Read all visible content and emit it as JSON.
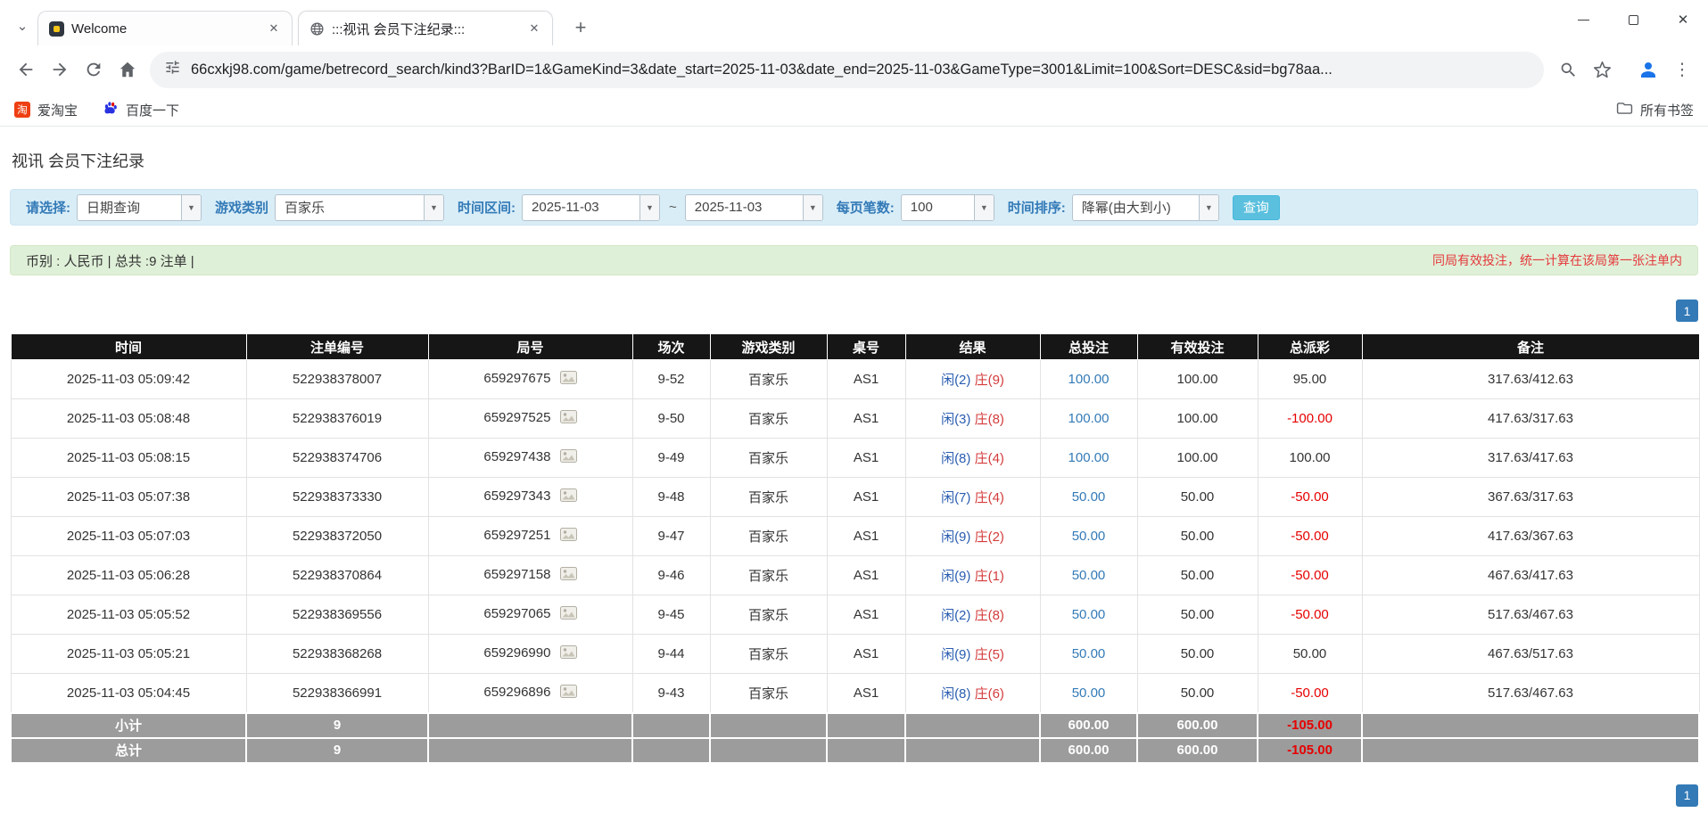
{
  "icons": {
    "chevron_down": "⌄",
    "combo_caret": "▼",
    "close": "✕",
    "plus": "+",
    "menu_dots": "⋮"
  },
  "browser": {
    "tabs": [
      {
        "title": "Welcome"
      },
      {
        "title": ":::视讯 会员下注纪录:::"
      }
    ],
    "url": "66cxkj98.com/game/betrecord_search/kind3?BarID=1&GameKind=3&date_start=2025-11-03&date_end=2025-11-03&GameType=3001&Limit=100&Sort=DESC&sid=bg78aa...",
    "bookmarks": {
      "taobao_label": "爱淘宝",
      "taobao_icon_text": "淘",
      "baidu_label": "百度一下",
      "all_bookmarks_label": "所有书签"
    }
  },
  "page": {
    "title": "视讯 会员下注纪录",
    "filters": {
      "select_label": "请选择:",
      "select_value": "日期查询",
      "game_type_label": "游戏类别",
      "game_type_value": "百家乐",
      "date_range_label": "时间区间:",
      "date_start": "2025-11-03",
      "date_separator": "~",
      "date_end": "2025-11-03",
      "page_size_label": "每页笔数:",
      "page_size_value": "100",
      "sort_label": "时间排序:",
      "sort_value": "降幂(由大到小)",
      "search_button": "查询"
    },
    "summary": {
      "left": "币别 : 人民币 | 总共 :9 注单 |",
      "right": "同局有效投注，统一计算在该局第一张注单内"
    },
    "pagination": "1",
    "table": {
      "headers": [
        "时间",
        "注单编号",
        "局号",
        "场次",
        "游戏类别",
        "桌号",
        "结果",
        "总投注",
        "有效投注",
        "总派彩",
        "备注"
      ],
      "rows": [
        {
          "time": "2025-11-03 05:09:42",
          "bet_id": "522938378007",
          "round_id": "659297675",
          "session": "9-52",
          "game": "百家乐",
          "table_no": "AS1",
          "result_player": "闲(2)",
          "result_banker": "庄(9)",
          "total_bet": "100.00",
          "valid_bet": "100.00",
          "payout": "95.00",
          "remark": "317.63/412.63"
        },
        {
          "time": "2025-11-03 05:08:48",
          "bet_id": "522938376019",
          "round_id": "659297525",
          "session": "9-50",
          "game": "百家乐",
          "table_no": "AS1",
          "result_player": "闲(3)",
          "result_banker": "庄(8)",
          "total_bet": "100.00",
          "valid_bet": "100.00",
          "payout": "-100.00",
          "remark": "417.63/317.63"
        },
        {
          "time": "2025-11-03 05:08:15",
          "bet_id": "522938374706",
          "round_id": "659297438",
          "session": "9-49",
          "game": "百家乐",
          "table_no": "AS1",
          "result_player": "闲(8)",
          "result_banker": "庄(4)",
          "total_bet": "100.00",
          "valid_bet": "100.00",
          "payout": "100.00",
          "remark": "317.63/417.63"
        },
        {
          "time": "2025-11-03 05:07:38",
          "bet_id": "522938373330",
          "round_id": "659297343",
          "session": "9-48",
          "game": "百家乐",
          "table_no": "AS1",
          "result_player": "闲(7)",
          "result_banker": "庄(4)",
          "total_bet": "50.00",
          "valid_bet": "50.00",
          "payout": "-50.00",
          "remark": "367.63/317.63"
        },
        {
          "time": "2025-11-03 05:07:03",
          "bet_id": "522938372050",
          "round_id": "659297251",
          "session": "9-47",
          "game": "百家乐",
          "table_no": "AS1",
          "result_player": "闲(9)",
          "result_banker": "庄(2)",
          "total_bet": "50.00",
          "valid_bet": "50.00",
          "payout": "-50.00",
          "remark": "417.63/367.63"
        },
        {
          "time": "2025-11-03 05:06:28",
          "bet_id": "522938370864",
          "round_id": "659297158",
          "session": "9-46",
          "game": "百家乐",
          "table_no": "AS1",
          "result_player": "闲(9)",
          "result_banker": "庄(1)",
          "total_bet": "50.00",
          "valid_bet": "50.00",
          "payout": "-50.00",
          "remark": "467.63/417.63"
        },
        {
          "time": "2025-11-03 05:05:52",
          "bet_id": "522938369556",
          "round_id": "659297065",
          "session": "9-45",
          "game": "百家乐",
          "table_no": "AS1",
          "result_player": "闲(2)",
          "result_banker": "庄(8)",
          "total_bet": "50.00",
          "valid_bet": "50.00",
          "payout": "-50.00",
          "remark": "517.63/467.63"
        },
        {
          "time": "2025-11-03 05:05:21",
          "bet_id": "522938368268",
          "round_id": "659296990",
          "session": "9-44",
          "game": "百家乐",
          "table_no": "AS1",
          "result_player": "闲(9)",
          "result_banker": "庄(5)",
          "total_bet": "50.00",
          "valid_bet": "50.00",
          "payout": "50.00",
          "remark": "467.63/517.63"
        },
        {
          "time": "2025-11-03 05:04:45",
          "bet_id": "522938366991",
          "round_id": "659296896",
          "session": "9-43",
          "game": "百家乐",
          "table_no": "AS1",
          "result_player": "闲(8)",
          "result_banker": "庄(6)",
          "total_bet": "50.00",
          "valid_bet": "50.00",
          "payout": "-50.00",
          "remark": "517.63/467.63"
        }
      ],
      "footer": [
        {
          "label": "小计",
          "count": "9",
          "total_bet": "600.00",
          "valid_bet": "600.00",
          "payout": "-105.00"
        },
        {
          "label": "总计",
          "count": "9",
          "total_bet": "600.00",
          "valid_bet": "600.00",
          "payout": "-105.00"
        }
      ]
    }
  }
}
